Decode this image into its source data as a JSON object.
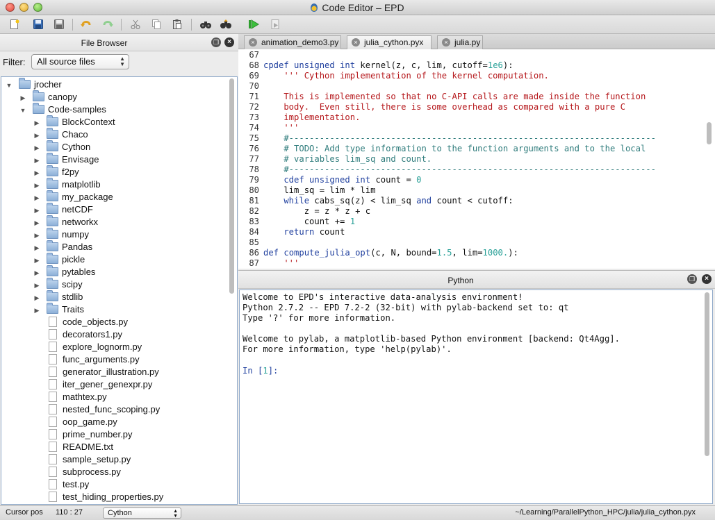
{
  "window": {
    "title": "Code Editor – EPD"
  },
  "toolbar": {
    "buttons": [
      "new-file",
      "save",
      "save-all",
      "undo",
      "redo",
      "cut",
      "copy",
      "paste",
      "find",
      "find-replace",
      "run",
      "run-selection"
    ]
  },
  "file_browser": {
    "title": "File Browser",
    "filter_label": "Filter:",
    "filter_value": "All source files",
    "root": "jrocher",
    "tree": [
      {
        "label": "jrocher",
        "kind": "folder",
        "open": true,
        "depth": 0
      },
      {
        "label": "canopy",
        "kind": "folder",
        "open": false,
        "depth": 1
      },
      {
        "label": "Code-samples",
        "kind": "folder",
        "open": true,
        "depth": 1
      },
      {
        "label": "BlockContext",
        "kind": "folder",
        "open": false,
        "depth": 2
      },
      {
        "label": "Chaco",
        "kind": "folder",
        "open": false,
        "depth": 2
      },
      {
        "label": "Cython",
        "kind": "folder",
        "open": false,
        "depth": 2
      },
      {
        "label": "Envisage",
        "kind": "folder",
        "open": false,
        "depth": 2
      },
      {
        "label": "f2py",
        "kind": "folder",
        "open": false,
        "depth": 2
      },
      {
        "label": "matplotlib",
        "kind": "folder",
        "open": false,
        "depth": 2
      },
      {
        "label": "my_package",
        "kind": "folder",
        "open": false,
        "depth": 2
      },
      {
        "label": "netCDF",
        "kind": "folder",
        "open": false,
        "depth": 2
      },
      {
        "label": "networkx",
        "kind": "folder",
        "open": false,
        "depth": 2
      },
      {
        "label": "numpy",
        "kind": "folder",
        "open": false,
        "depth": 2
      },
      {
        "label": "Pandas",
        "kind": "folder",
        "open": false,
        "depth": 2
      },
      {
        "label": "pickle",
        "kind": "folder",
        "open": false,
        "depth": 2
      },
      {
        "label": "pytables",
        "kind": "folder",
        "open": false,
        "depth": 2
      },
      {
        "label": "scipy",
        "kind": "folder",
        "open": false,
        "depth": 2
      },
      {
        "label": "stdlib",
        "kind": "folder",
        "open": false,
        "depth": 2
      },
      {
        "label": "Traits",
        "kind": "folder",
        "open": false,
        "depth": 2
      },
      {
        "label": "code_objects.py",
        "kind": "file",
        "depth": 2
      },
      {
        "label": "decorators1.py",
        "kind": "file",
        "depth": 2
      },
      {
        "label": "explore_lognorm.py",
        "kind": "file",
        "depth": 2
      },
      {
        "label": "func_arguments.py",
        "kind": "file",
        "depth": 2
      },
      {
        "label": "generator_illustration.py",
        "kind": "file",
        "depth": 2
      },
      {
        "label": "iter_gener_genexpr.py",
        "kind": "file",
        "depth": 2
      },
      {
        "label": "mathtex.py",
        "kind": "file",
        "depth": 2
      },
      {
        "label": "nested_func_scoping.py",
        "kind": "file",
        "depth": 2
      },
      {
        "label": "oop_game.py",
        "kind": "file",
        "depth": 2
      },
      {
        "label": "prime_number.py",
        "kind": "file",
        "depth": 2
      },
      {
        "label": "README.txt",
        "kind": "file",
        "depth": 2
      },
      {
        "label": "sample_setup.py",
        "kind": "file",
        "depth": 2
      },
      {
        "label": "subprocess.py",
        "kind": "file",
        "depth": 2
      },
      {
        "label": "test.py",
        "kind": "file",
        "depth": 2
      },
      {
        "label": "test_hiding_properties.py",
        "kind": "file",
        "depth": 2
      }
    ]
  },
  "editor": {
    "tabs": [
      {
        "label": "animation_demo3.py",
        "active": false
      },
      {
        "label": "julia_cython.pyx",
        "active": true
      },
      {
        "label": "julia.py",
        "active": false
      }
    ],
    "lines": [
      {
        "n": "67",
        "parts": []
      },
      {
        "n": "68",
        "parts": [
          [
            "kw",
            "cpdef unsigned int "
          ],
          [
            "",
            "kernel(z, c, lim, cutoff="
          ],
          [
            "num",
            "1e6"
          ],
          [
            "",
            "):"
          ]
        ]
      },
      {
        "n": "69",
        "parts": [
          [
            "str",
            "    ''' Cython implementation of the kernel computation."
          ]
        ]
      },
      {
        "n": "70",
        "parts": []
      },
      {
        "n": "71",
        "parts": [
          [
            "str",
            "    This is implemented so that no C-API calls are made inside the function"
          ]
        ]
      },
      {
        "n": "72",
        "parts": [
          [
            "str",
            "    body.  Even still, there is some overhead as compared with a pure C"
          ]
        ]
      },
      {
        "n": "73",
        "parts": [
          [
            "str",
            "    implementation."
          ]
        ]
      },
      {
        "n": "74",
        "parts": [
          [
            "str",
            "    '''"
          ]
        ]
      },
      {
        "n": "75",
        "parts": [
          [
            "cmt",
            "    #------------------------------------------------------------------------"
          ]
        ]
      },
      {
        "n": "76",
        "parts": [
          [
            "cmt",
            "    # TODO: Add type information to the function arguments and to the local"
          ]
        ]
      },
      {
        "n": "77",
        "parts": [
          [
            "cmt",
            "    # variables lim_sq and count."
          ]
        ]
      },
      {
        "n": "78",
        "parts": [
          [
            "cmt",
            "    #------------------------------------------------------------------------"
          ]
        ]
      },
      {
        "n": "79",
        "parts": [
          [
            "kw",
            "    cdef unsigned int "
          ],
          [
            "",
            "count = "
          ],
          [
            "num",
            "0"
          ]
        ]
      },
      {
        "n": "80",
        "parts": [
          [
            "",
            "    lim_sq = lim * lim"
          ]
        ]
      },
      {
        "n": "81",
        "parts": [
          [
            "kw",
            "    while "
          ],
          [
            "",
            "cabs_sq(z) < lim_sq "
          ],
          [
            "kw",
            "and "
          ],
          [
            "",
            "count < cutoff:"
          ]
        ]
      },
      {
        "n": "82",
        "parts": [
          [
            "",
            "        z = z * z + c"
          ]
        ]
      },
      {
        "n": "83",
        "parts": [
          [
            "",
            "        count += "
          ],
          [
            "num",
            "1"
          ]
        ]
      },
      {
        "n": "84",
        "parts": [
          [
            "kw",
            "    return "
          ],
          [
            "",
            "count"
          ]
        ]
      },
      {
        "n": "85",
        "parts": []
      },
      {
        "n": "86",
        "parts": [
          [
            "kw",
            "def "
          ],
          [
            "fn",
            "compute_julia_opt"
          ],
          [
            "",
            "(c, N, bound="
          ],
          [
            "num",
            "1.5"
          ],
          [
            "",
            ", lim="
          ],
          [
            "num",
            "1000."
          ],
          [
            "",
            "):"
          ]
        ]
      },
      {
        "n": "87",
        "parts": [
          [
            "str",
            "    '''"
          ]
        ]
      }
    ]
  },
  "python_pane": {
    "title": "Python",
    "lines": [
      "Welcome to EPD's interactive data-analysis environment!",
      "Python 2.7.2 -- EPD 7.2-2 (32-bit) with pylab-backend set to: qt",
      "Type '?' for more information.",
      "",
      "Welcome to pylab, a matplotlib-based Python environment [backend: Qt4Agg].",
      "For more information, type 'help(pylab)'.",
      ""
    ],
    "prompt_prefix": "In [",
    "prompt_number": "1",
    "prompt_suffix": "]:"
  },
  "status_bar": {
    "cursor_label": "Cursor pos",
    "cursor_value": "110 : 27",
    "language": "Cython",
    "path": "~/Learning/ParallelPython_HPC/julia/julia_cython.pyx"
  },
  "colors": {
    "keyword": "#1f3f9e",
    "string": "#b5171b",
    "comment": "#2f7c7c",
    "number": "#2aa198",
    "selection_border": "#8fa9c9"
  }
}
